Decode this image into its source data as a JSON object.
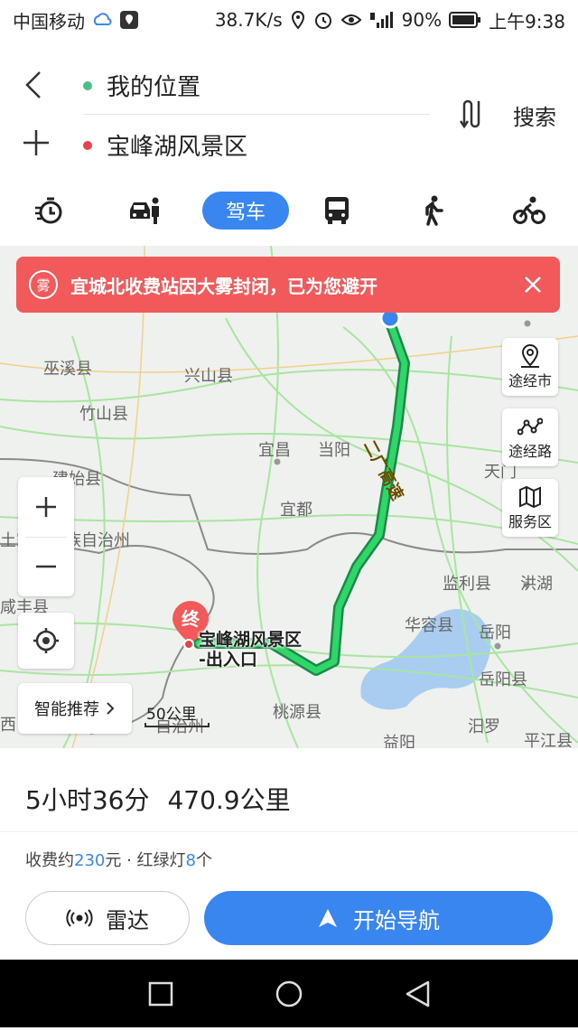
{
  "status": {
    "carrier": "中国移动",
    "speed": "38.7K/s",
    "battery": "90%",
    "time": "上午9:38"
  },
  "route": {
    "from": "我的位置",
    "to": "宝峰湖风景区",
    "from_dot_color": "#4cc08a",
    "to_dot_color": "#e8434a",
    "search_label": "搜索"
  },
  "modes": {
    "active_label": "驾车",
    "items": [
      "timer-icon",
      "car-taxi-icon",
      "drive",
      "bus-icon",
      "walk-icon",
      "bike-icon"
    ]
  },
  "map": {
    "fog_badge": "雾",
    "fog_text": "宜城北收费站因大雾封闭，已为您避开",
    "side": [
      "途经市",
      "途经路",
      "服务区"
    ],
    "smart_recommend": "智能推荐",
    "scale": "50公里",
    "dest_pin_label": "终",
    "dest_name_line1": "宝峰湖风景区",
    "dest_name_line2": "-出入口",
    "road_label": "二广高速",
    "place_labels": {
      "wuxi": "巫溪县",
      "xingshan": "兴山县",
      "zhushan": "竹山县",
      "jianshi": "建始县",
      "zizhizhou": "土家族苗族自治州",
      "yichang": "宜昌",
      "dangyang": "当阳",
      "yidu": "宜都",
      "tianmen": "天门",
      "jianli": "监利县",
      "honghu": "洪湖",
      "huarong": "华容县",
      "yueyang": "岳阳",
      "yueyangxian": "岳阳县",
      "taoyuan": "桃源县",
      "miluo": "汨罗",
      "pingjiang": "平江县",
      "yiyang": "益阳",
      "xianfeng": "咸丰县",
      "zizhi2": "自治州",
      "west": "西"
    },
    "route_color": "#26b55e",
    "traffic_color": "#2fd66a"
  },
  "summary": {
    "duration": "5小时36分",
    "distance": "470.9公里",
    "toll_prefix": "收费约",
    "toll_amount": "230",
    "toll_suffix": "元 · 红绿灯",
    "lights": "8",
    "lights_suffix": "个",
    "radar_label": "雷达",
    "nav_label": "开始导航"
  }
}
